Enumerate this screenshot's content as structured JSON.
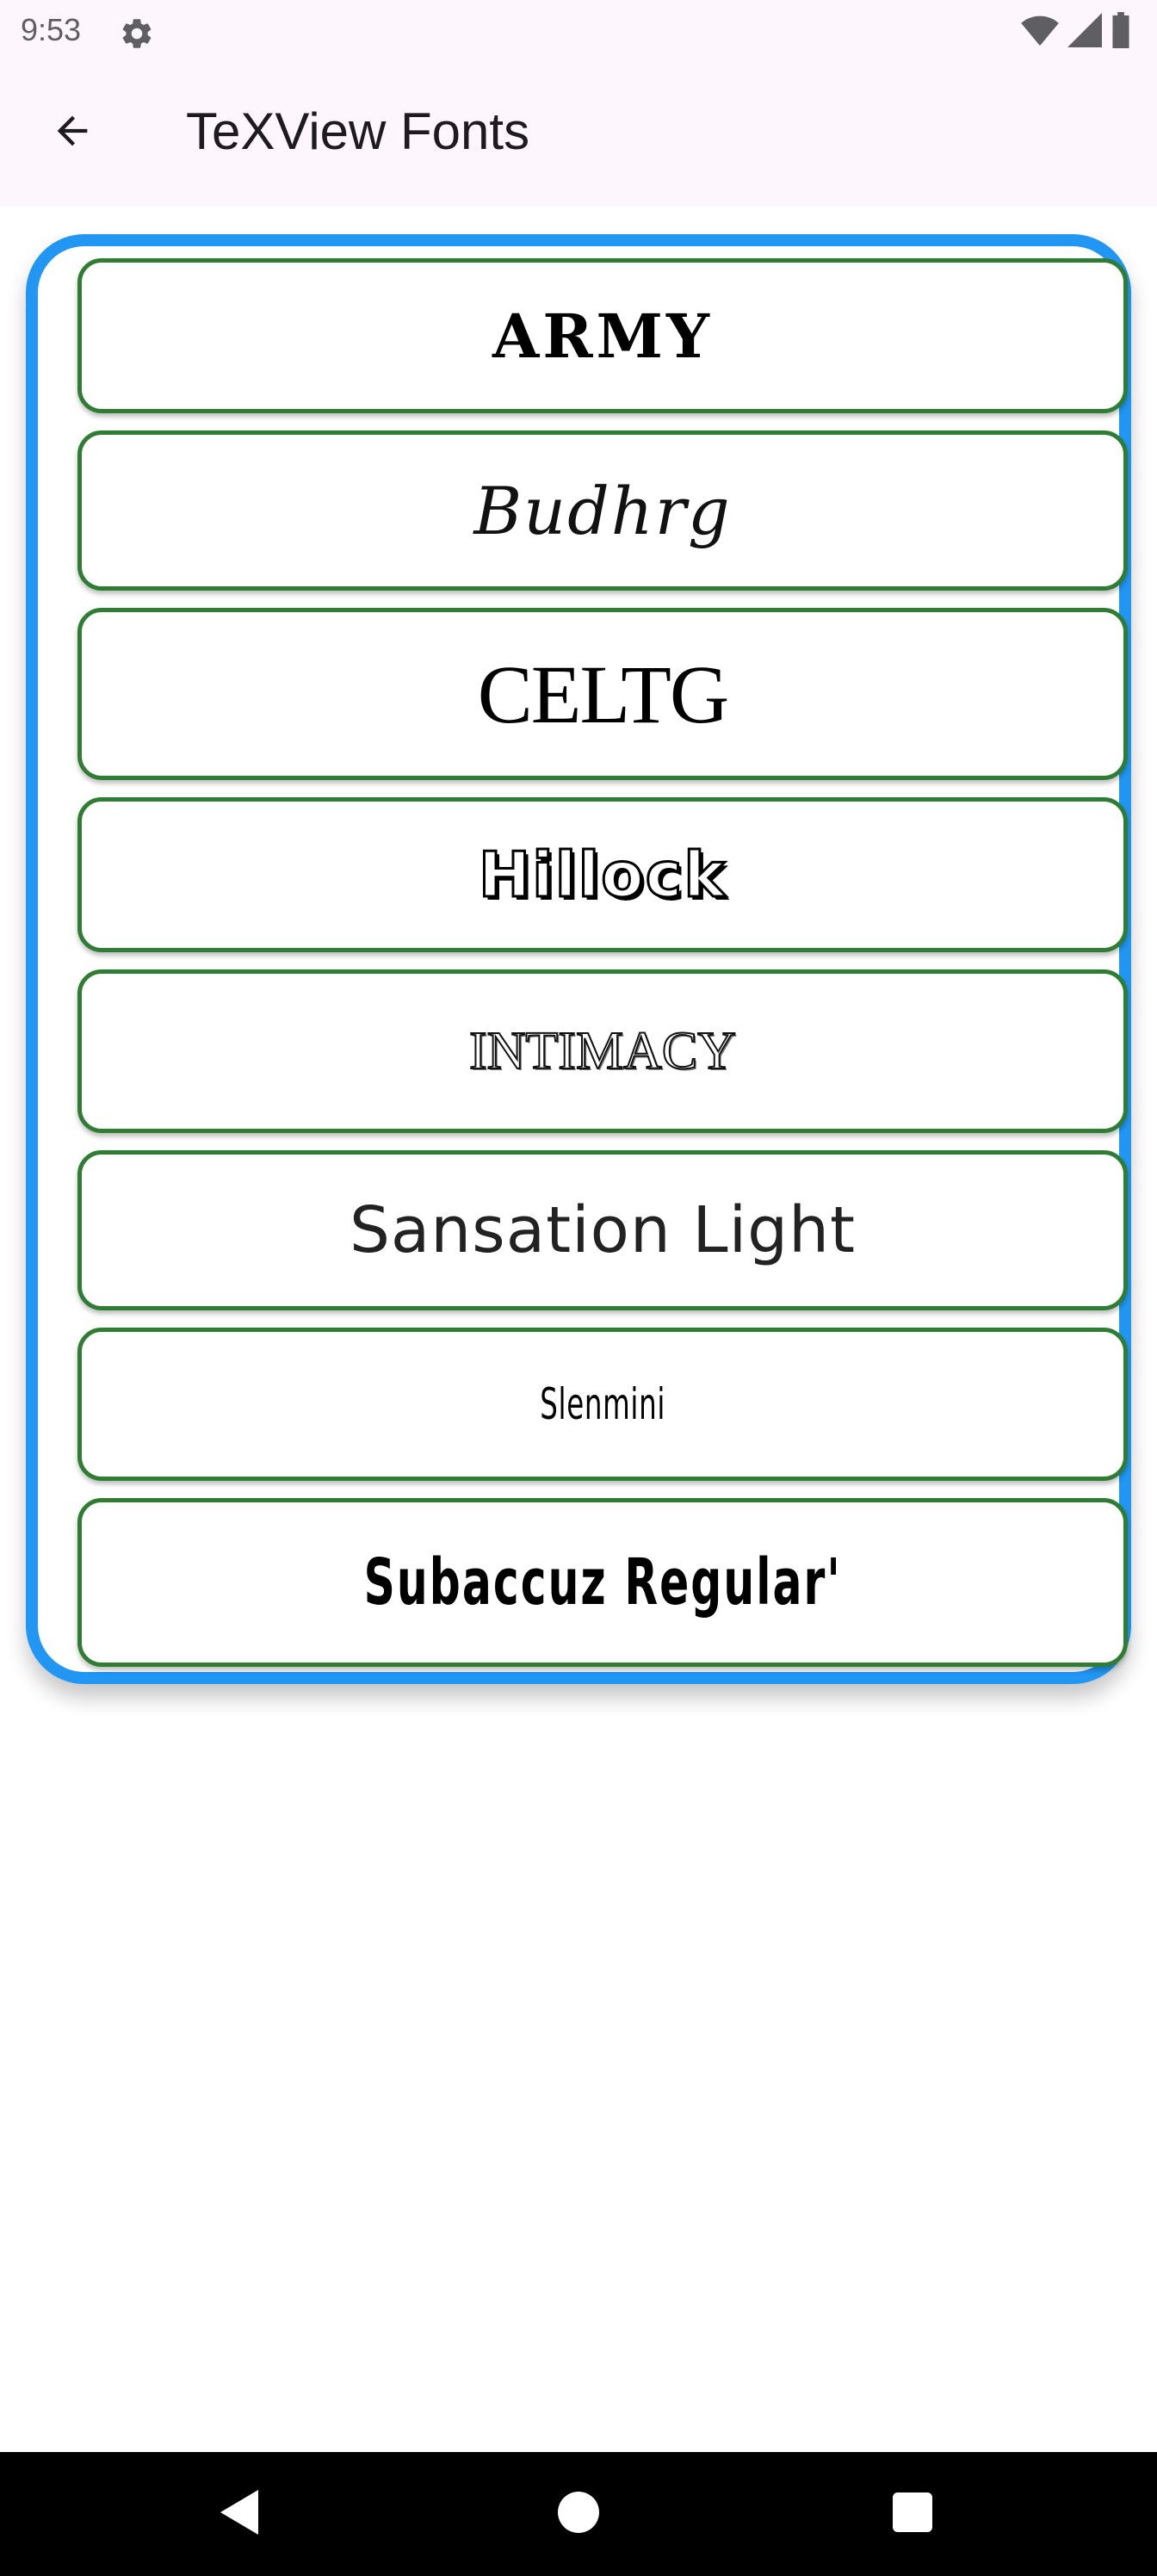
{
  "status_bar": {
    "time": "9:53",
    "icons": [
      "settings-gear-icon",
      "wifi-icon",
      "cellular-signal-icon",
      "battery-icon"
    ]
  },
  "app_bar": {
    "back_icon": "arrow-back-icon",
    "title": "TeXView Fonts"
  },
  "colors": {
    "outer_border": "#2196f3",
    "item_border": "#2e7d32",
    "bar_background": "#fdf7fd"
  },
  "fonts": [
    {
      "label": "ARMY"
    },
    {
      "label": "Budhrg"
    },
    {
      "label": "CELTG"
    },
    {
      "label": "Hillock"
    },
    {
      "label": "INTIMACY"
    },
    {
      "label": "Sansation Light"
    },
    {
      "label": "Slenmini"
    },
    {
      "label": "Subaccuz Regular'"
    }
  ],
  "nav_bar": {
    "icons": [
      "back-triangle-icon",
      "home-circle-icon",
      "recents-square-icon"
    ]
  }
}
